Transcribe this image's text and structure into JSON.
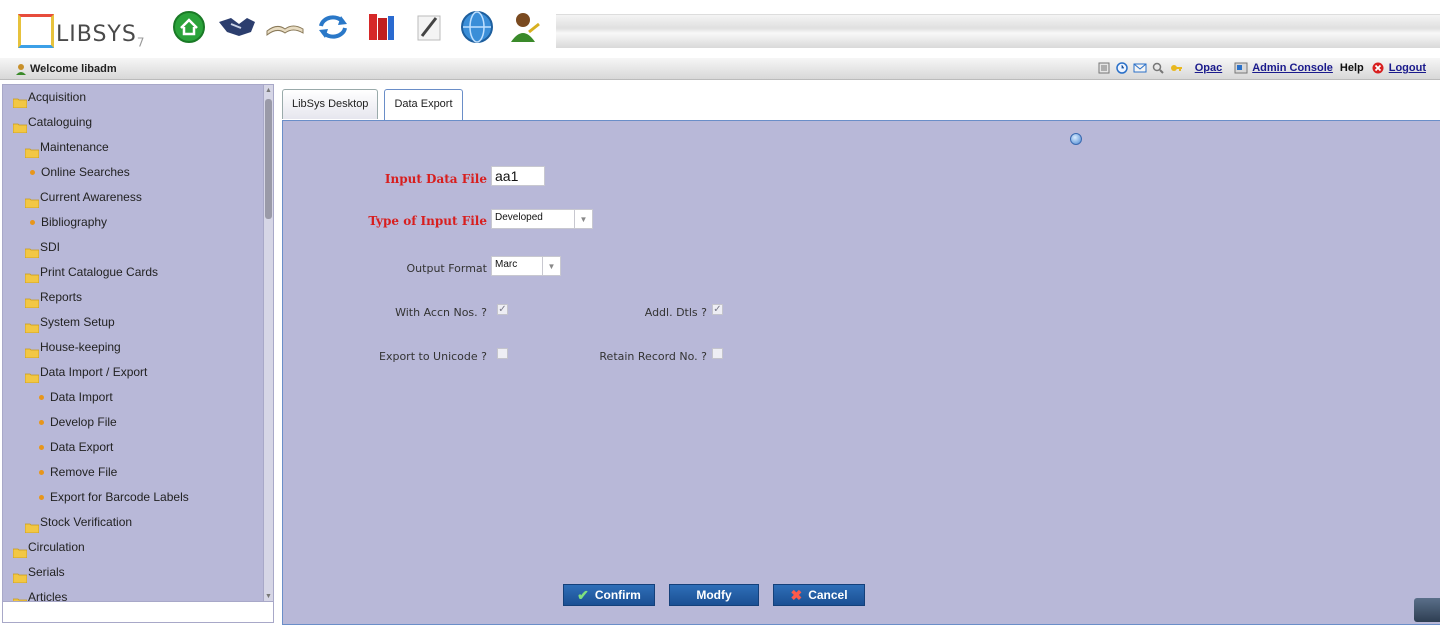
{
  "app": {
    "logo_text": "LIBSYS",
    "logo_version": "7"
  },
  "toolbar": {
    "icons": [
      "home-icon",
      "handshake-icon",
      "open-book-icon",
      "refresh-icon",
      "books-icon",
      "pencil-icon",
      "globe-icon",
      "user-icon"
    ]
  },
  "welcome": {
    "text": "Welcome libadm"
  },
  "header_links": {
    "opac": "Opac",
    "admin_console": "Admin Console",
    "help": "Help",
    "logout": "Logout"
  },
  "sidebar": {
    "items": [
      {
        "label": "Acquisition"
      },
      {
        "label": "Cataloguing"
      },
      {
        "label": "Maintenance"
      },
      {
        "label": "Online Searches"
      },
      {
        "label": "Current Awareness"
      },
      {
        "label": "Bibliography"
      },
      {
        "label": "SDI"
      },
      {
        "label": "Print Catalogue Cards"
      },
      {
        "label": "Reports"
      },
      {
        "label": "System Setup"
      },
      {
        "label": "House-keeping"
      },
      {
        "label": "Data Import / Export"
      },
      {
        "label": "Data Import"
      },
      {
        "label": "Develop File"
      },
      {
        "label": "Data Export"
      },
      {
        "label": "Remove File"
      },
      {
        "label": "Export for Barcode Labels"
      },
      {
        "label": "Stock Verification"
      },
      {
        "label": "Circulation"
      },
      {
        "label": "Serials"
      },
      {
        "label": "Articles"
      }
    ]
  },
  "tabs": [
    {
      "label": "LibSys Desktop"
    },
    {
      "label": "Data Export"
    }
  ],
  "form": {
    "input_data_file": {
      "label": "Input Data File",
      "value": "aa1"
    },
    "type_of_input_file": {
      "label": "Type of Input File",
      "value": "Developed"
    },
    "output_format": {
      "label": "Output Format",
      "value": "Marc"
    },
    "with_accn_nos": {
      "label": "With Accn Nos. ?",
      "checked": true
    },
    "addl_dtls": {
      "label": "Addl. Dtls ?",
      "checked": true
    },
    "export_to_unicode": {
      "label": "Export to Unicode ?",
      "checked": false
    },
    "retain_record_no": {
      "label": "Retain Record No. ?",
      "checked": false
    }
  },
  "buttons": {
    "confirm": "Confirm",
    "modify": "Modfy",
    "cancel": "Cancel"
  },
  "colors": {
    "panel_bg": "#b8b8d8",
    "required_label": "#d81e1e",
    "button_blue": "#1f5aa3",
    "folder_yellow": "#f2c744"
  }
}
